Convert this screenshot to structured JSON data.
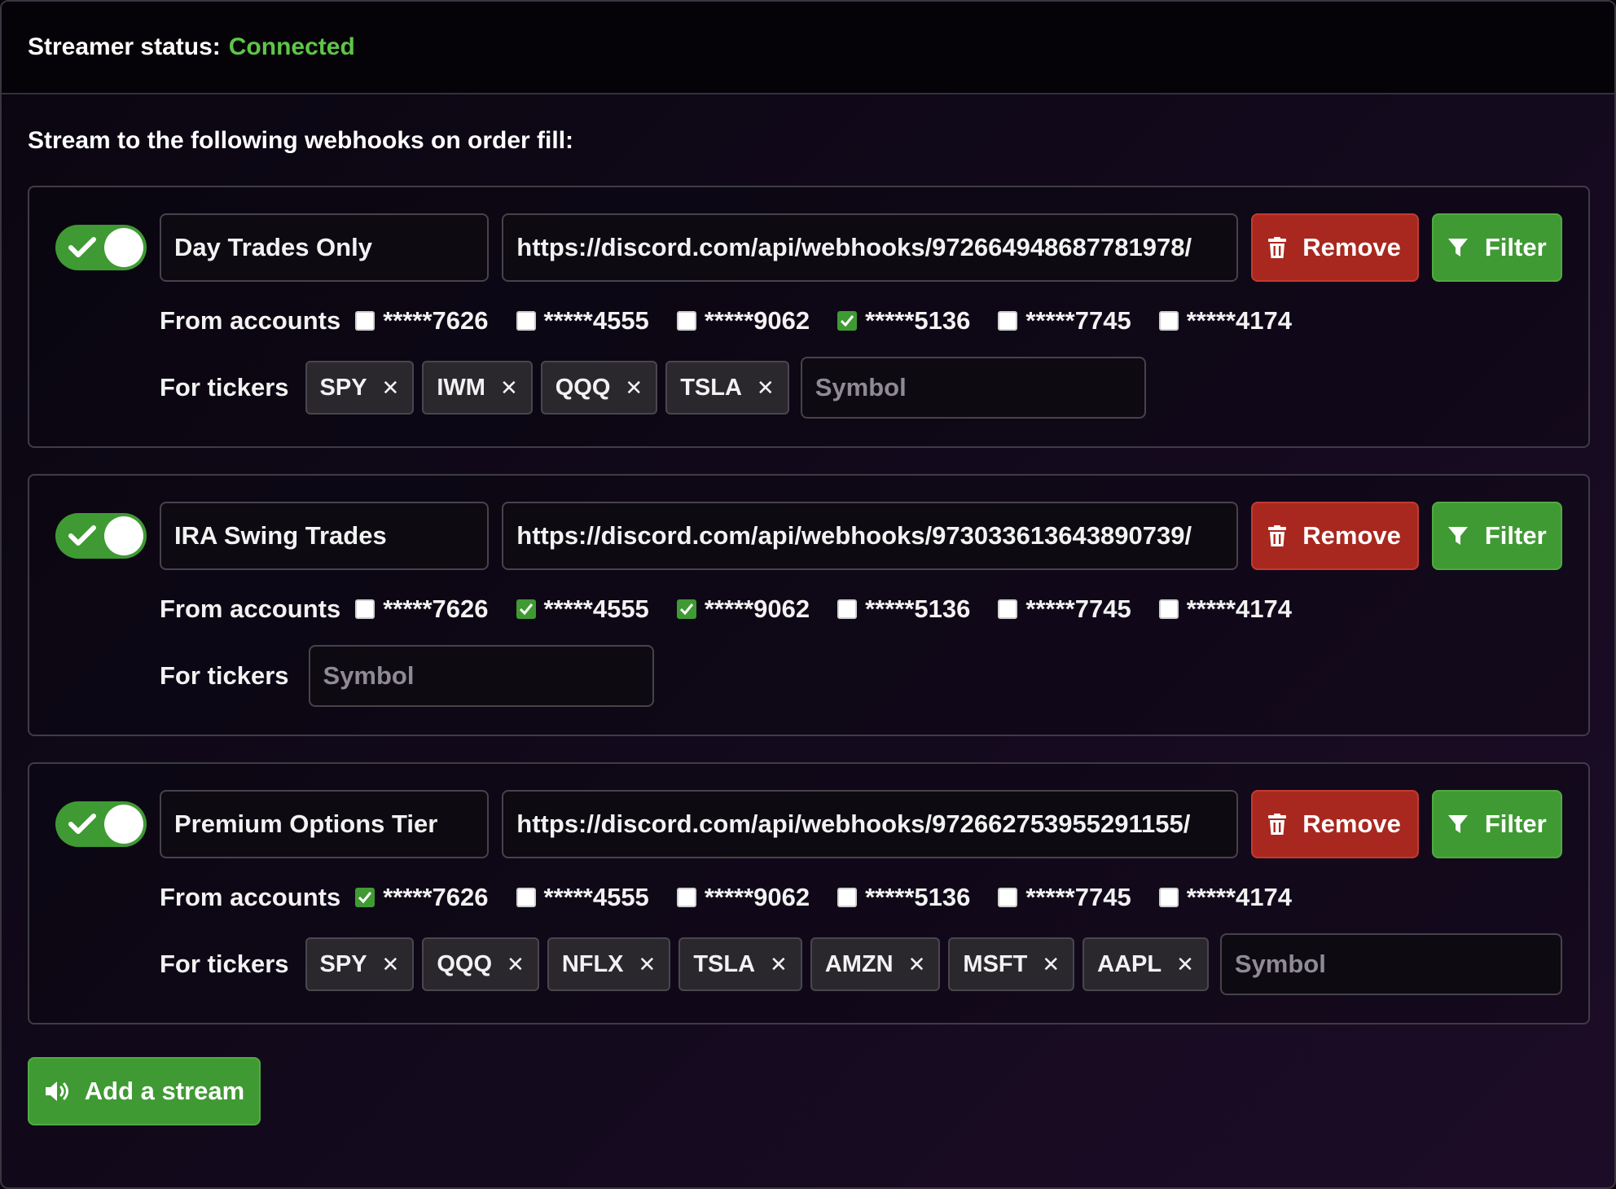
{
  "status": {
    "label": "Streamer status:",
    "value": "Connected",
    "value_color": "#5ec548"
  },
  "section_title": "Stream to the following webhooks on order fill:",
  "labels": {
    "remove": "Remove",
    "filter": "Filter",
    "from_accounts": "From accounts",
    "for_tickers": "For tickers",
    "add_stream": "Add a stream",
    "symbol_placeholder": "Symbol"
  },
  "accounts": [
    "*****7626",
    "*****4555",
    "*****9062",
    "*****5136",
    "*****7745",
    "*****4174"
  ],
  "streams": [
    {
      "enabled": true,
      "name": "Day Trades Only",
      "url": "https://discord.com/api/webhooks/972664948687781978/",
      "checked": [
        false,
        false,
        false,
        true,
        false,
        false
      ],
      "tickers": [
        "SPY",
        "IWM",
        "QQQ",
        "TSLA"
      ]
    },
    {
      "enabled": true,
      "name": "IRA Swing Trades",
      "url": "https://discord.com/api/webhooks/973033613643890739/",
      "checked": [
        false,
        true,
        true,
        false,
        false,
        false
      ],
      "tickers": []
    },
    {
      "enabled": true,
      "name": "Premium Options Tier",
      "url": "https://discord.com/api/webhooks/972662753955291155/",
      "checked": [
        true,
        false,
        false,
        false,
        false,
        false
      ],
      "tickers": [
        "SPY",
        "QQQ",
        "NFLX",
        "TSLA",
        "AMZN",
        "MSFT",
        "AAPL"
      ]
    }
  ],
  "icons": {
    "toggle": "check-icon",
    "remove": "trash-icon",
    "filter": "funnel-icon",
    "add": "speaker-icon",
    "tag_remove": "close-icon"
  },
  "colors": {
    "green": "#3f9a33",
    "red": "#a8281f"
  }
}
